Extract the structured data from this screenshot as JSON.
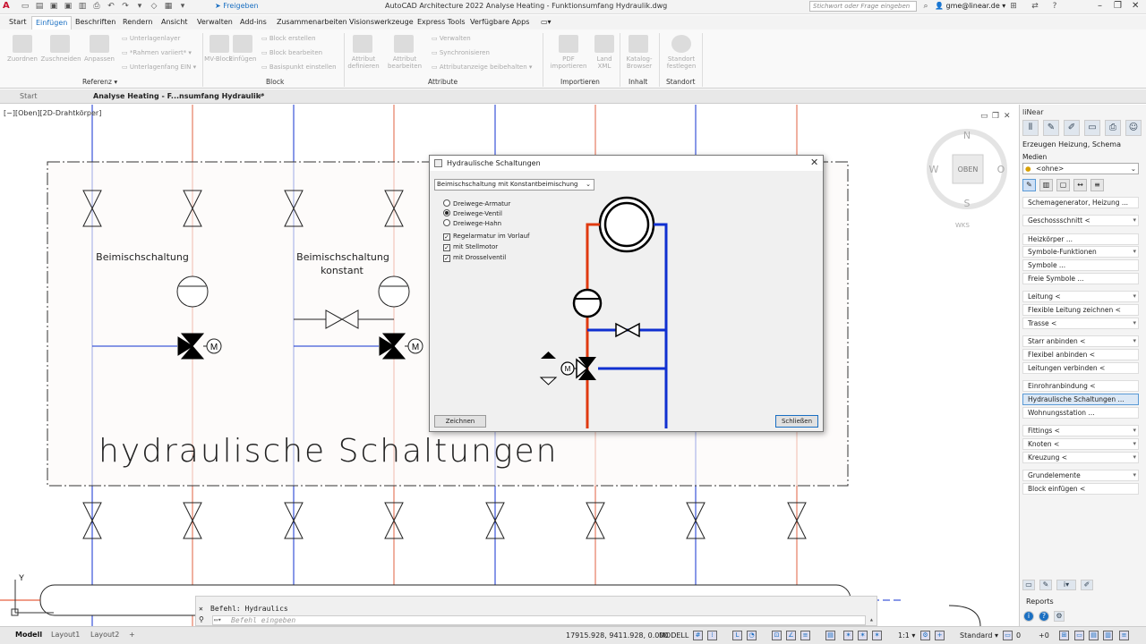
{
  "app": {
    "title": "AutoCAD Architecture 2022    Analyse Heating - Funktionsumfang Hydraulik.dwg",
    "share_label": "Freigeben",
    "search_placeholder": "Stichwort oder Frage eingeben",
    "user": "gme@linear.de"
  },
  "ribbon_tabs": [
    "Start",
    "Einfügen",
    "Beschriften",
    "Rendern",
    "Ansicht",
    "Verwalten",
    "Add-ins",
    "Zusammenarbeiten",
    "Visionswerkzeuge",
    "Express Tools",
    "Verfügbare Apps"
  ],
  "active_tab": "Einfügen",
  "ribbon": {
    "referenz": {
      "group": "Referenz",
      "buttons": [
        "Zuordnen",
        "Zuschneiden",
        "Anpassen"
      ],
      "small": [
        "Unterlagenlayer",
        "*Rahmen variiert*",
        "Unterlagenfang EIN"
      ]
    },
    "block": {
      "group": "Block",
      "buttons": [
        "MV-Block",
        "Einfügen"
      ],
      "small": [
        "Block erstellen",
        "Block bearbeiten",
        "Basispunkt einstellen"
      ]
    },
    "attribute": {
      "group": "Attribute",
      "buttons": [
        "Attribut definieren",
        "Attribut bearbeiten"
      ],
      "small": [
        "Verwalten",
        "Synchronisieren",
        "Attributanzeige beibehalten"
      ]
    },
    "importieren": {
      "group": "Importieren",
      "buttons": [
        "PDF importieren",
        "Land XML"
      ]
    },
    "inhalt": {
      "group": "Inhalt",
      "buttons": [
        "Katalog-Browser"
      ]
    },
    "standort": {
      "group": "Standort",
      "buttons": [
        "Standort festlegen"
      ]
    }
  },
  "doc_tabs": [
    "Start",
    "Analyse Heating - F...nsumfang Hydraulik*"
  ],
  "view_label": "[−][Oben][2D-Drahtkörper]",
  "drawing": {
    "label1": "Beimischschaltung",
    "label2_line1": "Beimischschaltung",
    "label2_line2": "konstant",
    "big_title": "hydraulische Schaltungen",
    "motor": "M",
    "axis_y": "Y"
  },
  "viewcube": {
    "n": "N",
    "s": "S",
    "w": "W",
    "o": "O",
    "face": "OBEN",
    "wcs": "WKS"
  },
  "command": {
    "history": "Befehl: Hydraulics",
    "placeholder": "Befehl eingeben"
  },
  "status": {
    "layout_tabs": [
      "Modell",
      "Layout1",
      "Layout2"
    ],
    "coords": "17915.928, 9411.928, 0.000",
    "mode": "MODELL",
    "scale": "1:1",
    "style": "Standard",
    "value1": "0",
    "value2": "+0"
  },
  "palette": {
    "title": "liNear",
    "section": "Erzeugen Heizung, Schema",
    "media_label": "Medien",
    "media_value": "<ohne>",
    "items": [
      {
        "label": "Schemagenerator, Heizung ...",
        "dd": false
      },
      {
        "label": "Geschossschnitt <",
        "dd": true
      },
      {
        "label": "Heizkörper ...",
        "dd": false
      },
      {
        "label": "Symbole-Funktionen",
        "dd": true
      },
      {
        "label": "Symbole ...",
        "dd": false
      },
      {
        "label": "Freie Symbole ...",
        "dd": false
      },
      {
        "label": "Leitung <",
        "dd": true
      },
      {
        "label": "Flexible Leitung zeichnen <",
        "dd": false
      },
      {
        "label": "Trasse <",
        "dd": true
      },
      {
        "label": "Starr anbinden <",
        "dd": true
      },
      {
        "label": "Flexibel anbinden <",
        "dd": false
      },
      {
        "label": "Leitungen verbinden <",
        "dd": false
      },
      {
        "label": "Einrohranbindung <",
        "dd": false
      },
      {
        "label": "Hydraulische Schaltungen ...",
        "dd": false,
        "selected": true
      },
      {
        "label": "Wohnungsstation ...",
        "dd": false
      },
      {
        "label": "Fittings <",
        "dd": true
      },
      {
        "label": "Knoten <",
        "dd": true
      },
      {
        "label": "Kreuzung <",
        "dd": true
      },
      {
        "label": "Grundelemente",
        "dd": true
      },
      {
        "label": "Block einfügen <",
        "dd": false
      }
    ],
    "reports": "Reports"
  },
  "dialog": {
    "title": "Hydraulische Schaltungen",
    "selected": "Beimischschaltung mit Konstantbeimischung",
    "radios": [
      {
        "label": "Dreiwege-Armatur",
        "checked": false
      },
      {
        "label": "Dreiwege-Ventil",
        "checked": true
      },
      {
        "label": "Dreiwege-Hahn",
        "checked": false
      }
    ],
    "checks": [
      {
        "label": "Regelarmatur im Vorlauf",
        "checked": true
      },
      {
        "label": "mit Stellmotor",
        "checked": true
      },
      {
        "label": "mit Drosselventil",
        "checked": true
      }
    ],
    "draw_button": "Zeichnen",
    "close_button": "Schließen",
    "motor": "M"
  },
  "colors": {
    "accent": "#1a6fc2",
    "supply": "#e03a10",
    "return": "#1030d0",
    "brand": "#c8102e"
  }
}
